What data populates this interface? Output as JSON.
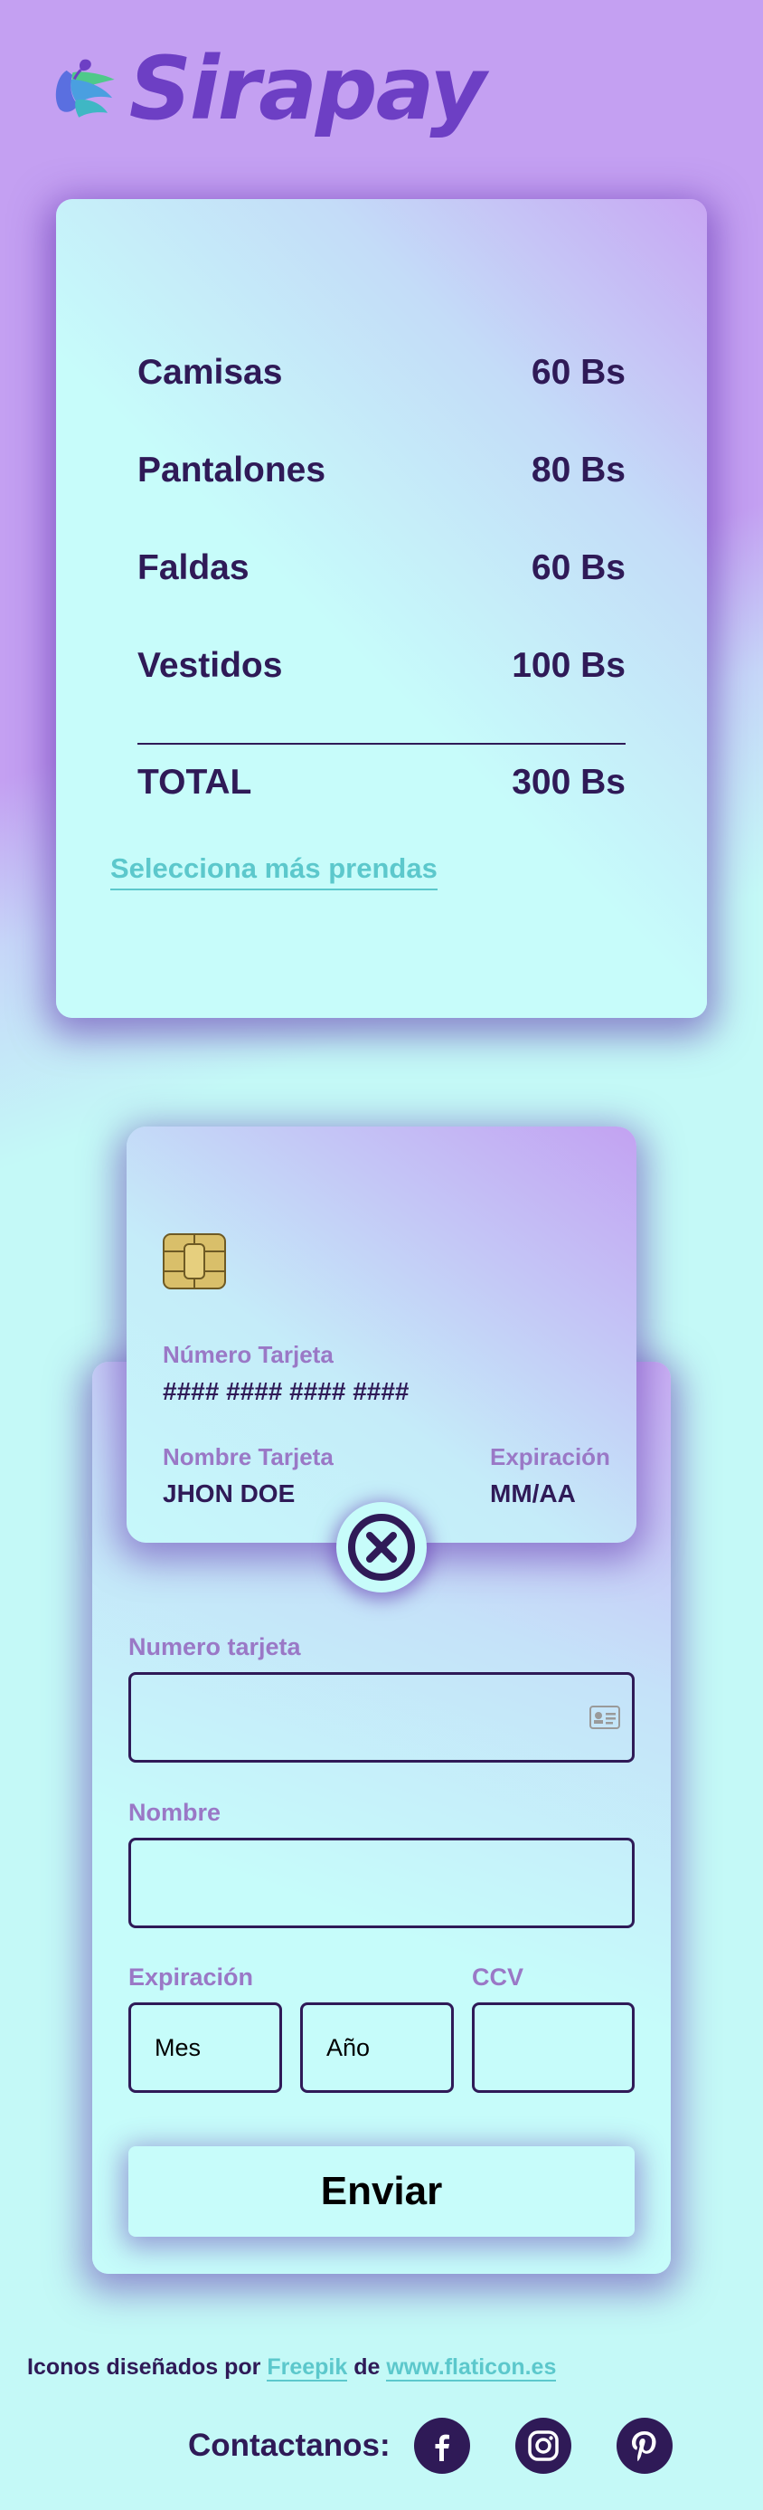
{
  "brand": {
    "name": "Sirapay",
    "logo_icon": "leaves-logo-icon"
  },
  "cart": {
    "items": [
      {
        "name": "Camisas",
        "price": "60 Bs"
      },
      {
        "name": "Pantalones",
        "price": "80 Bs"
      },
      {
        "name": "Faldas",
        "price": "60 Bs"
      },
      {
        "name": "Vestidos",
        "price": "100 Bs"
      }
    ],
    "total_label": "TOTAL",
    "total_value": "300 Bs",
    "more_link": "Selecciona más prendas"
  },
  "card_preview": {
    "number_label": "Número Tarjeta",
    "number_value": "#### #### #### ####",
    "name_label": "Nombre Tarjeta",
    "name_value": "JHON DOE",
    "expiry_label": "Expiración",
    "expiry_value": "MM/AA"
  },
  "form": {
    "card_number_label": "Numero tarjeta",
    "card_number_value": "",
    "name_label": "Nombre",
    "name_value": "",
    "expiry_label": "Expiración",
    "month_placeholder": "Mes",
    "year_placeholder": "Año",
    "ccv_label": "CCV",
    "ccv_value": "",
    "submit_label": "Enviar"
  },
  "footer": {
    "credits_prefix": "Iconos diseñados por",
    "credits_author": "Freepik",
    "credits_mid": "de",
    "credits_site": "www.flaticon.es",
    "contact_label": "Contactanos:",
    "socials": [
      "facebook-icon",
      "instagram-icon",
      "pinterest-icon"
    ]
  },
  "colors": {
    "primary_dark": "#2f1a57",
    "accent_teal": "#5cc8cc",
    "label_purple": "#9a78c6",
    "brand_purple": "#6d3fc4",
    "bg_purple": "#c4a0f2",
    "bg_cyan": "#c4f9f7"
  }
}
